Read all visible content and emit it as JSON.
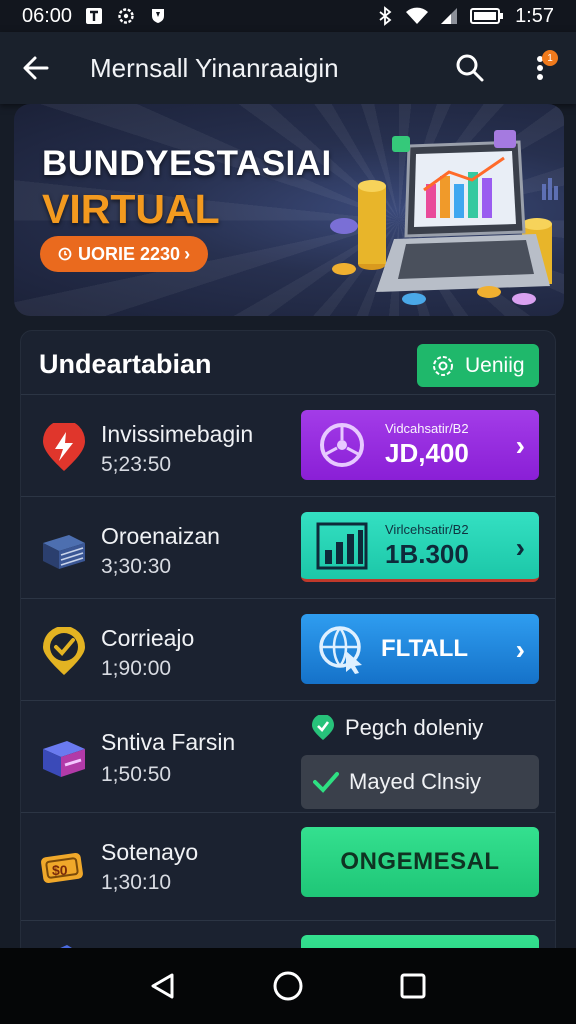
{
  "status_bar": {
    "time_left": "06:00",
    "time_right": "1:57",
    "icons_left": [
      "notification-t-icon",
      "settings-icon",
      "shield-icon"
    ],
    "icons_right": [
      "bluetooth-icon",
      "wifi-icon",
      "signal-icon",
      "battery-icon"
    ]
  },
  "app_bar": {
    "title": "Mernsall Yinanraaigin",
    "back_icon": "arrow-left-icon",
    "search_icon": "search-icon",
    "menu_icon": "more-vert-icon",
    "notification_count": "1"
  },
  "banner": {
    "title": "BUNDYESTASIAI",
    "subtitle": "VIRTUAL",
    "pill_label": "UORIE 2230",
    "colors": {
      "subtitle": "#f39a1f",
      "pill": "#ea6a1e"
    }
  },
  "card": {
    "title": "Undeartabian",
    "header_button": "Ueniig",
    "rows": [
      {
        "name": "Invissimebagin",
        "time": "5;23:50",
        "icon": "red-pin-icon",
        "action_small": "Vidcahsatir/B2",
        "action_big": "JD,400",
        "action_icon": "wheel-icon",
        "action_color": "#a33ce8"
      },
      {
        "name": "Oroenaizan",
        "time": "3;30:30",
        "icon": "books-icon",
        "action_small": "Virlcehsatir/B2",
        "action_big": "1B.300",
        "action_icon": "bar-chart-icon",
        "action_color": "#34e0c2"
      },
      {
        "name": "Corrieajo",
        "time": "1;90:00",
        "icon": "check-pin-icon",
        "action_label": "FLTALL",
        "action_icon": "globe-pointer-icon",
        "action_color": "#2f9df0"
      },
      {
        "name": "Sntiva Farsin",
        "time": "1;50:50",
        "icon": "box-icon",
        "status_line": "Pegch doleniy",
        "status_button": "Mayed Clnsiy"
      },
      {
        "name": "Sotenayo",
        "time": "1;30:10",
        "icon": "money-icon",
        "action_label": "ONGEMESAL",
        "action_color": "#34e08f"
      }
    ]
  },
  "nav_bar": {
    "back": "triangle-back-icon",
    "home": "circle-home-icon",
    "recents": "square-recents-icon"
  }
}
